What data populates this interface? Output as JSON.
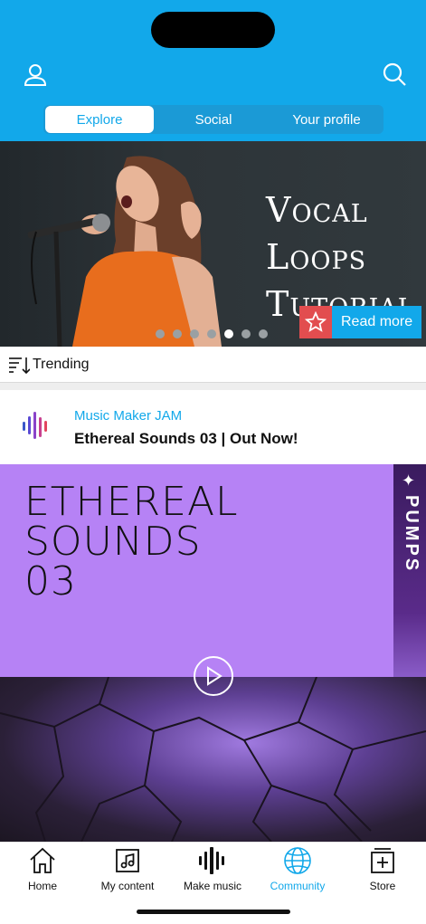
{
  "header": {
    "tabs": [
      "Explore",
      "Social",
      "Your profile"
    ],
    "active_tab": "Explore",
    "accent_color": "#12a8ea"
  },
  "icons": {
    "profile": "user-icon",
    "search": "search-icon"
  },
  "hero": {
    "title_line1": "Vocal Loops",
    "title_line2": "Tutorial",
    "read_more_label": "Read more",
    "slide_count": 7,
    "active_slide": 5
  },
  "feed": {
    "sort_label": "Trending"
  },
  "post": {
    "source": "Music Maker JAM",
    "title": "Ethereal Sounds 03 | Out Now!",
    "cover_title": "ETHEREAL\nSOUNDS\n03",
    "side_label": "PUMPS"
  },
  "nav": {
    "items": [
      {
        "label": "Home",
        "icon": "home-icon"
      },
      {
        "label": "My content",
        "icon": "folder-music-icon"
      },
      {
        "label": "Make music",
        "icon": "waveform-icon"
      },
      {
        "label": "Community",
        "icon": "globe-icon"
      },
      {
        "label": "Store",
        "icon": "store-plus-icon"
      }
    ],
    "active": "Community"
  }
}
